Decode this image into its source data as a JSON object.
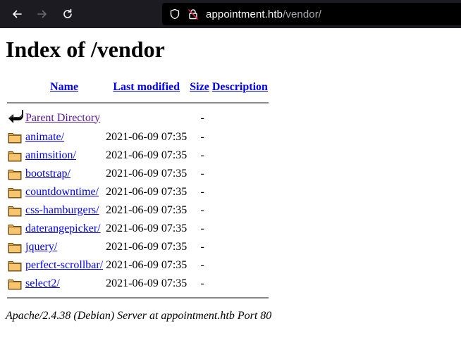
{
  "browser": {
    "url_host": "appointment.htb",
    "url_path": "/vendor/"
  },
  "page": {
    "title": "Index of /vendor",
    "columns": {
      "name": "Name",
      "last_modified": "Last modified",
      "size": "Size",
      "description": "Description"
    },
    "parent": {
      "label": "Parent Directory",
      "size": "-"
    },
    "entries": [
      {
        "name": "animate/",
        "modified": "2021-06-09 07:35",
        "size": "-"
      },
      {
        "name": "animsition/",
        "modified": "2021-06-09 07:35",
        "size": "-"
      },
      {
        "name": "bootstrap/",
        "modified": "2021-06-09 07:35",
        "size": "-"
      },
      {
        "name": "countdowntime/",
        "modified": "2021-06-09 07:35",
        "size": "-"
      },
      {
        "name": "css-hamburgers/",
        "modified": "2021-06-09 07:35",
        "size": "-"
      },
      {
        "name": "daterangepicker/",
        "modified": "2021-06-09 07:35",
        "size": "-"
      },
      {
        "name": "jquery/",
        "modified": "2021-06-09 07:35",
        "size": "-"
      },
      {
        "name": "perfect-scrollbar/",
        "modified": "2021-06-09 07:35",
        "size": "-"
      },
      {
        "name": "select2/",
        "modified": "2021-06-09 07:35",
        "size": "-"
      }
    ],
    "footer": "Apache/2.4.38 (Debian) Server at appointment.htb Port 80"
  }
}
